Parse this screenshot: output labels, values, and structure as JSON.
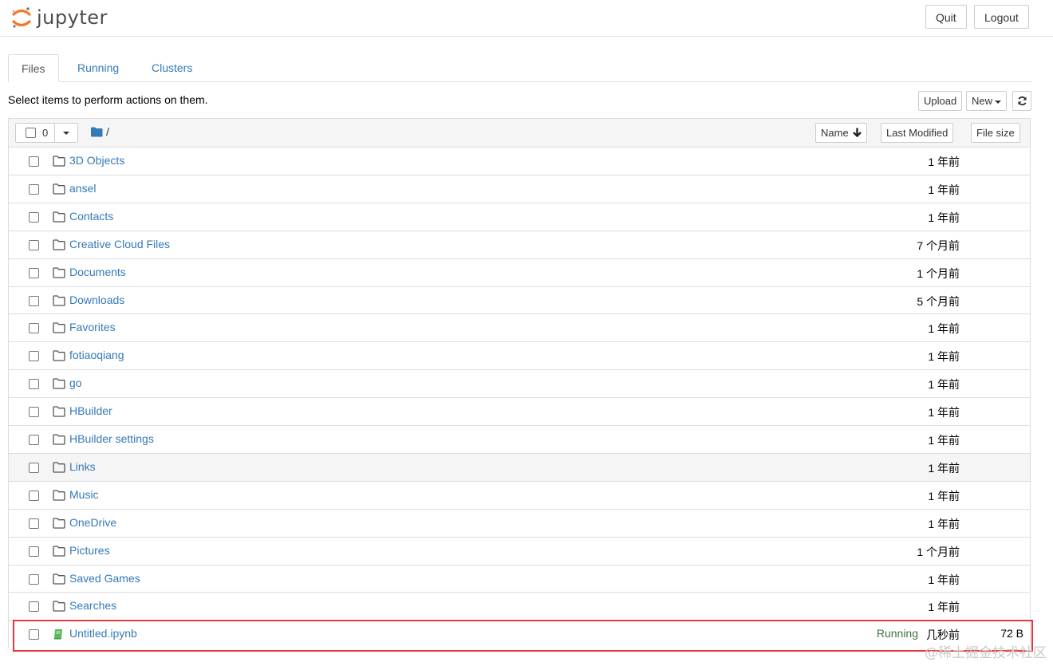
{
  "header": {
    "logo_text": "jupyter",
    "quit_label": "Quit",
    "logout_label": "Logout"
  },
  "tabs": [
    {
      "label": "Files",
      "active": true
    },
    {
      "label": "Running",
      "active": false
    },
    {
      "label": "Clusters",
      "active": false
    }
  ],
  "toolbar": {
    "instructions": "Select items to perform actions on them.",
    "upload_label": "Upload",
    "new_label": "New",
    "refresh_icon": "refresh-icon"
  },
  "list_header": {
    "selected_count": "0",
    "path": "/",
    "sort_name_label": "Name",
    "sort_modified_label": "Last Modified",
    "sort_size_label": "File size"
  },
  "files": [
    {
      "name": "3D Objects",
      "type": "folder",
      "modified": "1 年前"
    },
    {
      "name": "ansel",
      "type": "folder",
      "modified": "1 年前"
    },
    {
      "name": "Contacts",
      "type": "folder",
      "modified": "1 年前"
    },
    {
      "name": "Creative Cloud Files",
      "type": "folder",
      "modified": "7 个月前"
    },
    {
      "name": "Documents",
      "type": "folder",
      "modified": "1 个月前"
    },
    {
      "name": "Downloads",
      "type": "folder",
      "modified": "5 个月前"
    },
    {
      "name": "Favorites",
      "type": "folder",
      "modified": "1 年前"
    },
    {
      "name": "fotiaoqiang",
      "type": "folder",
      "modified": "1 年前"
    },
    {
      "name": "go",
      "type": "folder",
      "modified": "1 年前"
    },
    {
      "name": "HBuilder",
      "type": "folder",
      "modified": "1 年前"
    },
    {
      "name": "HBuilder settings",
      "type": "folder",
      "modified": "1 年前"
    },
    {
      "name": "Links",
      "type": "folder",
      "modified": "1 年前"
    },
    {
      "name": "Music",
      "type": "folder",
      "modified": "1 年前"
    },
    {
      "name": "OneDrive",
      "type": "folder",
      "modified": "1 年前"
    },
    {
      "name": "Pictures",
      "type": "folder",
      "modified": "1 个月前"
    },
    {
      "name": "Saved Games",
      "type": "folder",
      "modified": "1 年前"
    },
    {
      "name": "Searches",
      "type": "folder",
      "modified": "1 年前"
    },
    {
      "name": "Untitled.ipynb",
      "type": "notebook",
      "modified": "几秒前",
      "size": "72 B",
      "status": "Running"
    }
  ],
  "colors": {
    "link": "#337ab7",
    "running": "#3c763d",
    "highlight_border": "#e8373e",
    "logo_orange": "#f37726"
  },
  "watermark": "@稀土掘金技术社区"
}
